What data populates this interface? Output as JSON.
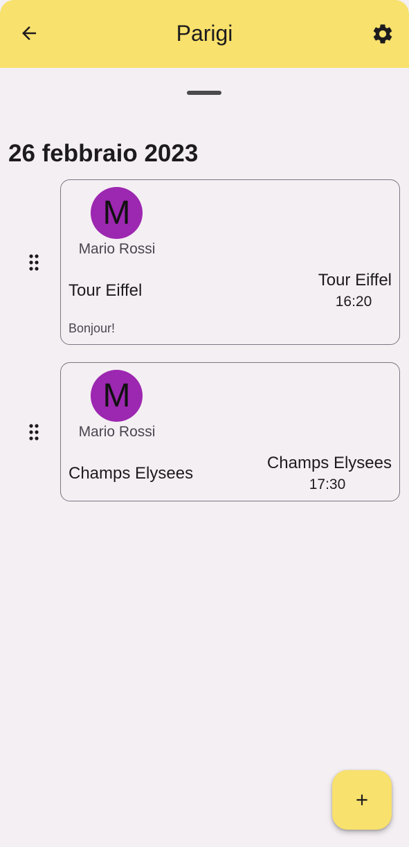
{
  "header": {
    "title": "Parigi",
    "back_icon": "arrow-left-icon",
    "settings_icon": "gear-icon",
    "color": "#f8e16c"
  },
  "date_heading": "26 febbraio 2023",
  "entries": [
    {
      "avatar_letter": "M",
      "avatar_color": "#9c27b0",
      "author": "Mario Rossi",
      "title": "Tour Eiffel",
      "location": "Tour Eiffel",
      "time": "16:20",
      "note": "Bonjour!"
    },
    {
      "avatar_letter": "M",
      "avatar_color": "#9c27b0",
      "author": "Mario Rossi",
      "title": "Champs Elysees",
      "location": "Champs Elysees",
      "time": "17:30",
      "note": ""
    }
  ],
  "fab": {
    "icon": "plus-icon"
  }
}
